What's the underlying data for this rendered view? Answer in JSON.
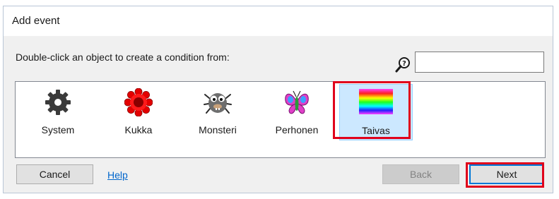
{
  "window": {
    "title": "Add event"
  },
  "instruction": "Double-click an object to create a condition from:",
  "search": {
    "icon": "search-help-icon",
    "value": "",
    "placeholder": ""
  },
  "objects": [
    {
      "label": "System",
      "icon": "gear-icon",
      "selected": false
    },
    {
      "label": "Kukka",
      "icon": "flower-icon",
      "selected": false
    },
    {
      "label": "Monsteri",
      "icon": "monster-icon",
      "selected": false
    },
    {
      "label": "Perhonen",
      "icon": "butterfly-icon",
      "selected": false
    },
    {
      "label": "Taivas",
      "icon": "sky-gradient-icon",
      "selected": true
    }
  ],
  "buttons": {
    "cancel": "Cancel",
    "help": "Help",
    "back": "Back",
    "next": "Next"
  },
  "colors": {
    "highlight": "#e0001b",
    "selection": "#cce8ff",
    "link": "#0066cc"
  }
}
